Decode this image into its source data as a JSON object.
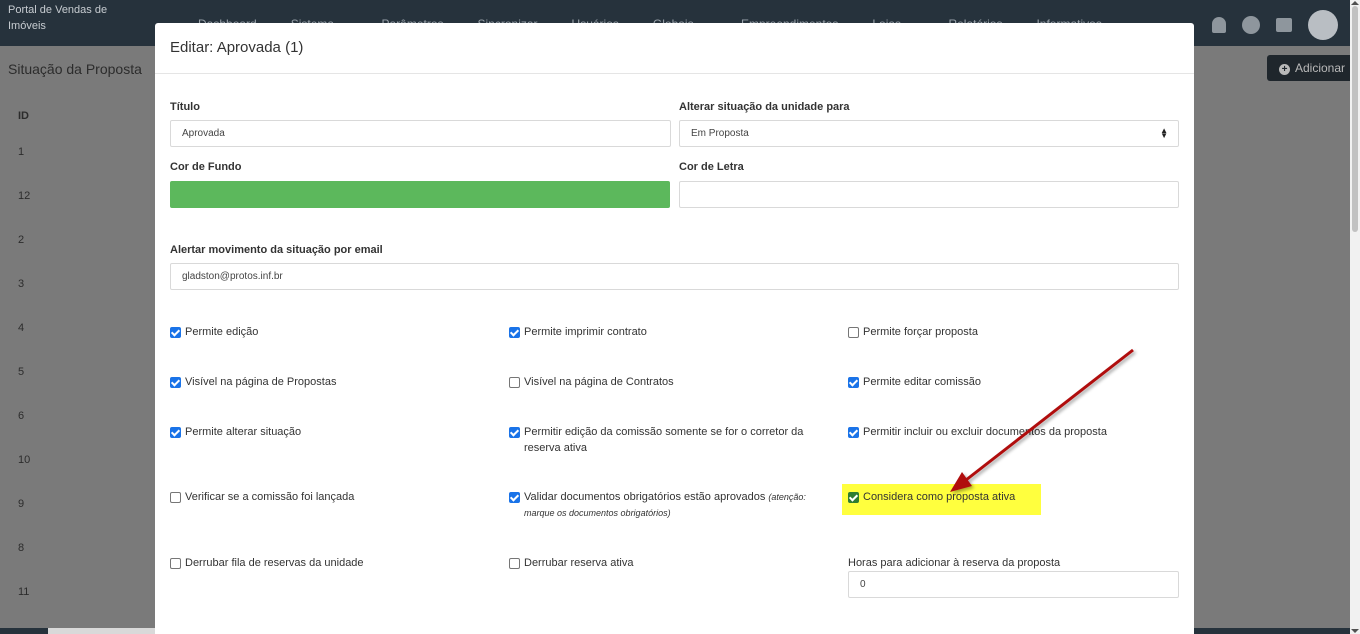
{
  "app": {
    "logo_text": "Portal de Vendas de Imóveis",
    "nav": [
      "Dashboard",
      "Sistema ⌄",
      "Parâmetros",
      "Sincronizar",
      "Usuários",
      "Globais ⌄",
      "Empreendimentos",
      "Lojas ⌄",
      "Relatórios",
      "Informativos"
    ]
  },
  "page": {
    "title": "Situação da Proposta",
    "add_label": "Adicionar",
    "id_header": "ID",
    "ids": [
      "1",
      "12",
      "2",
      "3",
      "4",
      "5",
      "6",
      "10",
      "9",
      "8",
      "11"
    ]
  },
  "modal": {
    "title": "Editar: Aprovada (1)",
    "titulo_label": "Título",
    "titulo_value": "Aprovada",
    "alterar_label": "Alterar situação da unidade para",
    "alterar_value": "Em Proposta",
    "cor_fundo_label": "Cor de Fundo",
    "cor_fundo_color": "#5cb85c",
    "cor_letra_label": "Cor de Letra",
    "cor_letra_color": "#ffffff",
    "email_label": "Alertar movimento da situação por email",
    "email_value": "gladston@protos.inf.br",
    "checks": {
      "permite_edicao": "Permite edição",
      "permite_imprimir": "Permite imprimir contrato",
      "permite_forcar": "Permite forçar proposta",
      "visivel_propostas": "Visível na página de Propostas",
      "visivel_contratos": "Visível na página de Contratos",
      "permite_editar_comissao": "Permite editar comissão",
      "permite_alterar_situacao": "Permite alterar situação",
      "permitir_edicao_comissao": "Permitir edição da comissão somente se for o corretor da reserva ativa",
      "permitir_incluir_docs": "Permitir incluir ou excluir documentos da proposta",
      "verificar_comissao": "Verificar se a comissão foi lançada",
      "validar_docs": "Validar documentos obrigatórios estão aprovados",
      "validar_docs_note": "(atenção: marque os documentos obrigatórios)",
      "considera_ativa": "Considera como proposta ativa",
      "derrubar_fila": "Derrubar fila de reservas da unidade",
      "derrubar_reserva": "Derrubar reserva ativa"
    },
    "horas_label": "Horas para adicionar à reserva da proposta",
    "horas_value": "0"
  },
  "annotation": {
    "highlight_color": "#ffff3e",
    "arrow_color": "#b01010"
  }
}
